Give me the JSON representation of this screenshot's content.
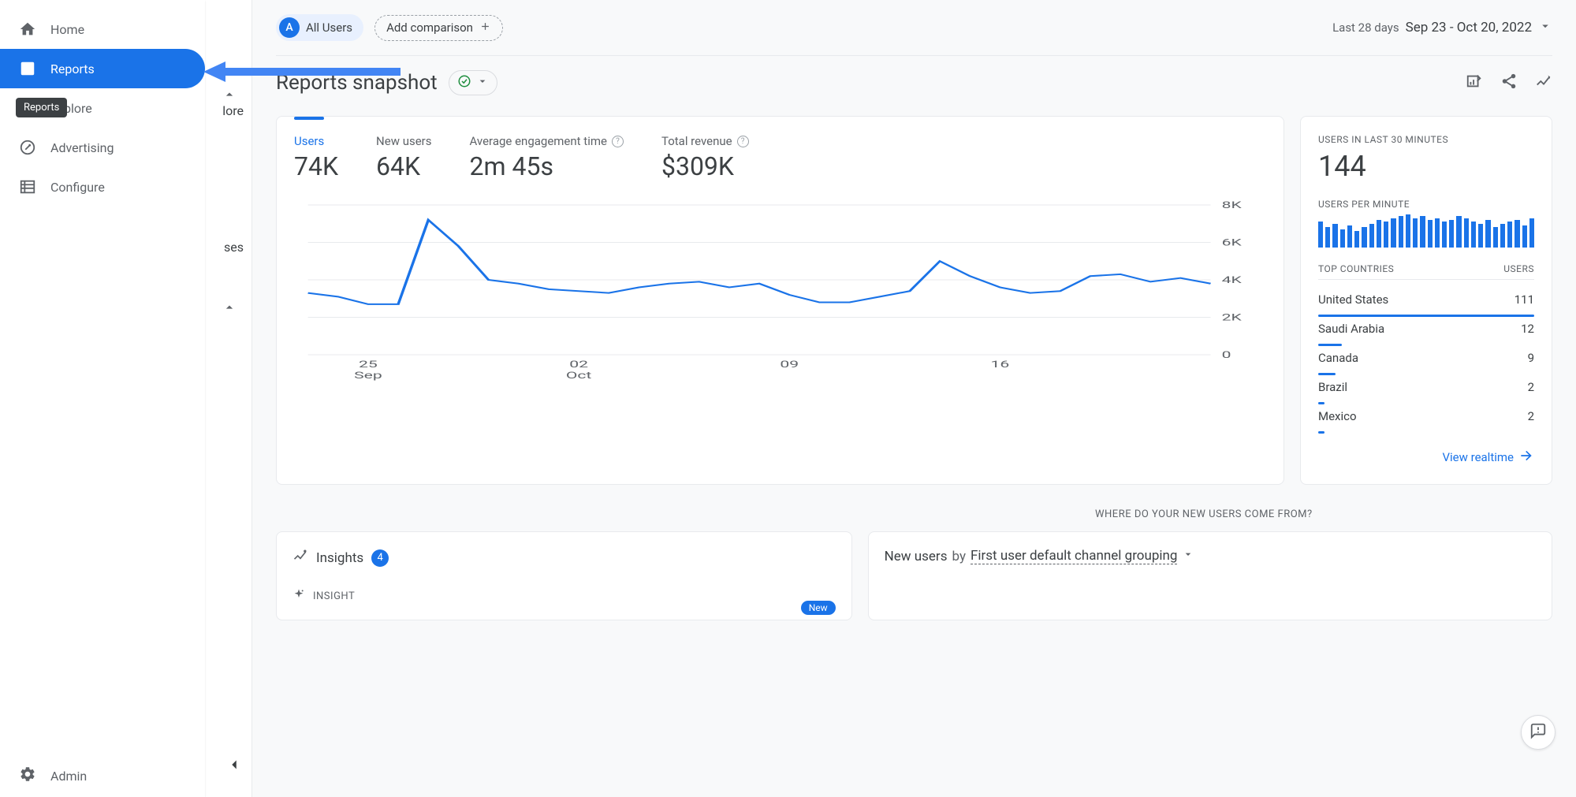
{
  "sidebar": {
    "items": [
      {
        "label": "Home"
      },
      {
        "label": "Reports"
      },
      {
        "label": "Explore"
      },
      {
        "label": "Advertising"
      },
      {
        "label": "Configure"
      }
    ],
    "admin": "Admin",
    "tooltip": "Reports"
  },
  "topbar": {
    "segment_badge": "A",
    "segment_label": "All Users",
    "add_comparison": "Add comparison",
    "period_label": "Last 28 days",
    "date_range": "Sep 23 - Oct 20, 2022"
  },
  "page": {
    "title": "Reports snapshot"
  },
  "metrics": [
    {
      "label": "Users",
      "value": "74K"
    },
    {
      "label": "New users",
      "value": "64K"
    },
    {
      "label": "Average engagement time",
      "value": "2m 45s"
    },
    {
      "label": "Total revenue",
      "value": "$309K"
    }
  ],
  "realtime": {
    "label1": "USERS IN LAST 30 MINUTES",
    "value": "144",
    "label2": "USERS PER MINUTE",
    "countries_header_left": "TOP COUNTRIES",
    "countries_header_right": "USERS",
    "countries": [
      {
        "name": "United States",
        "users": "111",
        "width": 100
      },
      {
        "name": "Saudi Arabia",
        "users": "12",
        "width": 11
      },
      {
        "name": "Canada",
        "users": "9",
        "width": 8
      },
      {
        "name": "Brazil",
        "users": "2",
        "width": 3
      },
      {
        "name": "Mexico",
        "users": "2",
        "width": 3
      }
    ],
    "link": "View realtime"
  },
  "section2": {
    "label": "WHERE DO YOUR NEW USERS COME FROM?",
    "insights_title": "Insights",
    "insights_count": "4",
    "insight_sub": "INSIGHT",
    "new_badge": "New",
    "channel_prefix": "New users",
    "channel_by": " by ",
    "channel_dim": "First user default channel grouping"
  },
  "chart_data": {
    "type": "line",
    "ylabel": "",
    "ylim": [
      0,
      8000
    ],
    "yticks": [
      "0",
      "2K",
      "4K",
      "6K",
      "8K"
    ],
    "x_categories": [
      "25 Sep",
      "",
      "02 Oct",
      "",
      "09",
      "",
      "16",
      ""
    ],
    "values": [
      3300,
      3100,
      2700,
      2700,
      7200,
      5800,
      4000,
      3800,
      3500,
      3400,
      3300,
      3600,
      3800,
      3900,
      3600,
      3800,
      3200,
      2800,
      2800,
      3100,
      3400,
      5000,
      4200,
      3600,
      3300,
      3400,
      4200,
      4300,
      3900,
      4100,
      3800
    ]
  },
  "mini_bars": [
    28,
    22,
    26,
    20,
    24,
    18,
    22,
    26,
    30,
    28,
    32,
    34,
    36,
    32,
    34,
    30,
    32,
    28,
    30,
    34,
    32,
    28,
    26,
    30,
    22,
    26,
    28,
    30,
    24,
    32
  ],
  "partial": {
    "ses": "ses",
    "lore": "lore"
  }
}
